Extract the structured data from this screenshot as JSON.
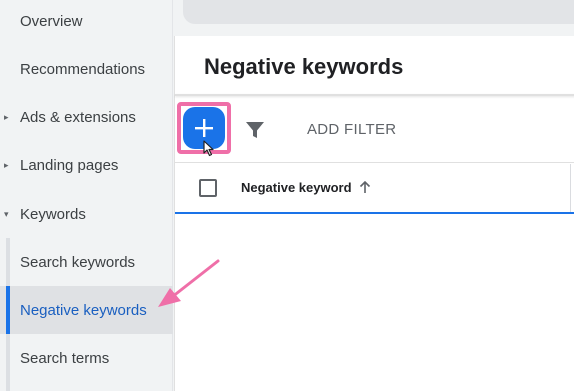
{
  "sidebar": {
    "items": [
      {
        "label": "Overview"
      },
      {
        "label": "Recommendations"
      },
      {
        "label": "Ads & extensions",
        "caret": "▸"
      },
      {
        "label": "Landing pages",
        "caret": "▸"
      },
      {
        "label": "Keywords",
        "caret": "▾"
      }
    ],
    "subitems": [
      {
        "label": "Search keywords"
      },
      {
        "label": "Negative keywords",
        "active": true
      },
      {
        "label": "Search terms"
      }
    ]
  },
  "main": {
    "title": "Negative keywords",
    "toolbar": {
      "add_icon": "plus-icon",
      "filter_icon": "filter-icon",
      "add_filter_label": "ADD FILTER"
    },
    "table": {
      "columns": [
        {
          "label": "Negative keyword",
          "sort": "ascending",
          "sort_icon": "arrow-up-icon"
        }
      ]
    }
  },
  "colors": {
    "accent": "#1a73e8",
    "highlight": "#ef6fa8",
    "active_text": "#1a5fc0"
  }
}
